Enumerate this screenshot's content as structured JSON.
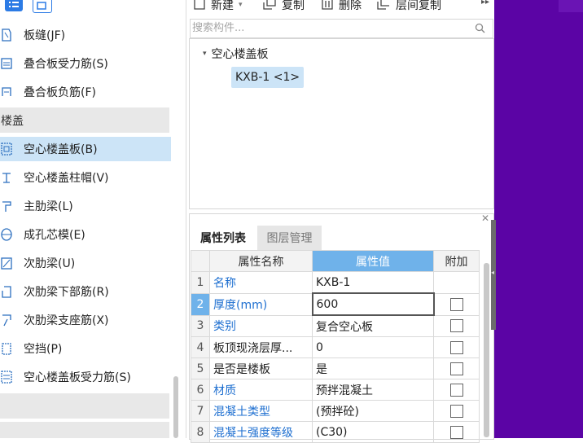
{
  "left_nav": {
    "items": [
      {
        "label": "板缝(JF)",
        "icon": "slab-seam-icon"
      },
      {
        "label": "叠合板受力筋(S)",
        "icon": "stressed-rebar-icon"
      },
      {
        "label": "叠合板负筋(F)",
        "icon": "negative-rebar-icon"
      },
      {
        "label": "空心楼盖板(B)",
        "icon": "hollow-slab-icon"
      },
      {
        "label": "空心楼盖柱帽(V)",
        "icon": "column-cap-icon"
      },
      {
        "label": "主肋梁(L)",
        "icon": "main-rib-beam-icon"
      },
      {
        "label": "成孔芯模(E)",
        "icon": "hole-core-mold-icon"
      },
      {
        "label": "次肋梁(U)",
        "icon": "secondary-rib-beam-icon"
      },
      {
        "label": "次肋梁下部筋(R)",
        "icon": "bottom-rebar-icon"
      },
      {
        "label": "次肋梁支座筋(X)",
        "icon": "support-rebar-icon"
      },
      {
        "label": "空挡(P)",
        "icon": "gap-icon"
      },
      {
        "label": "空心楼盖板受力筋(S)",
        "icon": "hollow-slab-rebar-icon"
      }
    ],
    "group_label": "楼盖"
  },
  "toolbar": {
    "new_label": "新建",
    "copy_label": "复制",
    "delete_label": "删除",
    "floor_copy_label": "层间复制"
  },
  "search": {
    "placeholder": "搜索构件..."
  },
  "tree": {
    "root_label": "空心楼盖板",
    "child_label": "KXB-1 <1>"
  },
  "attr": {
    "tabs": [
      "属性列表",
      "图层管理"
    ],
    "headers": [
      "属性名称",
      "属性值",
      "附加"
    ],
    "rows": [
      {
        "idx": "1",
        "name": "名称",
        "value": "KXB-1",
        "blue": true,
        "has_checkbox": false
      },
      {
        "idx": "2",
        "name": "厚度(mm)",
        "value": "600",
        "blue": true,
        "has_checkbox": true
      },
      {
        "idx": "3",
        "name": "类别",
        "value": "复合空心板",
        "blue": true,
        "has_checkbox": true
      },
      {
        "idx": "4",
        "name": "板顶现浇层厚...",
        "value": "0",
        "blue": false,
        "has_checkbox": true
      },
      {
        "idx": "5",
        "name": "是否是楼板",
        "value": "是",
        "blue": false,
        "has_checkbox": true
      },
      {
        "idx": "6",
        "name": "材质",
        "value": "预拌混凝土",
        "blue": true,
        "has_checkbox": true
      },
      {
        "idx": "7",
        "name": "混凝土类型",
        "value": "(预拌砼)",
        "blue": true,
        "has_checkbox": true
      },
      {
        "idx": "8",
        "name": "混凝土强度等级",
        "value": "(C30)",
        "blue": true,
        "has_checkbox": true
      }
    ]
  },
  "colors": {
    "selection": "#cce4f7",
    "header_active": "#6fb2ea",
    "link_blue": "#1e6fd0",
    "canvas_purple": "#5b04a5"
  }
}
